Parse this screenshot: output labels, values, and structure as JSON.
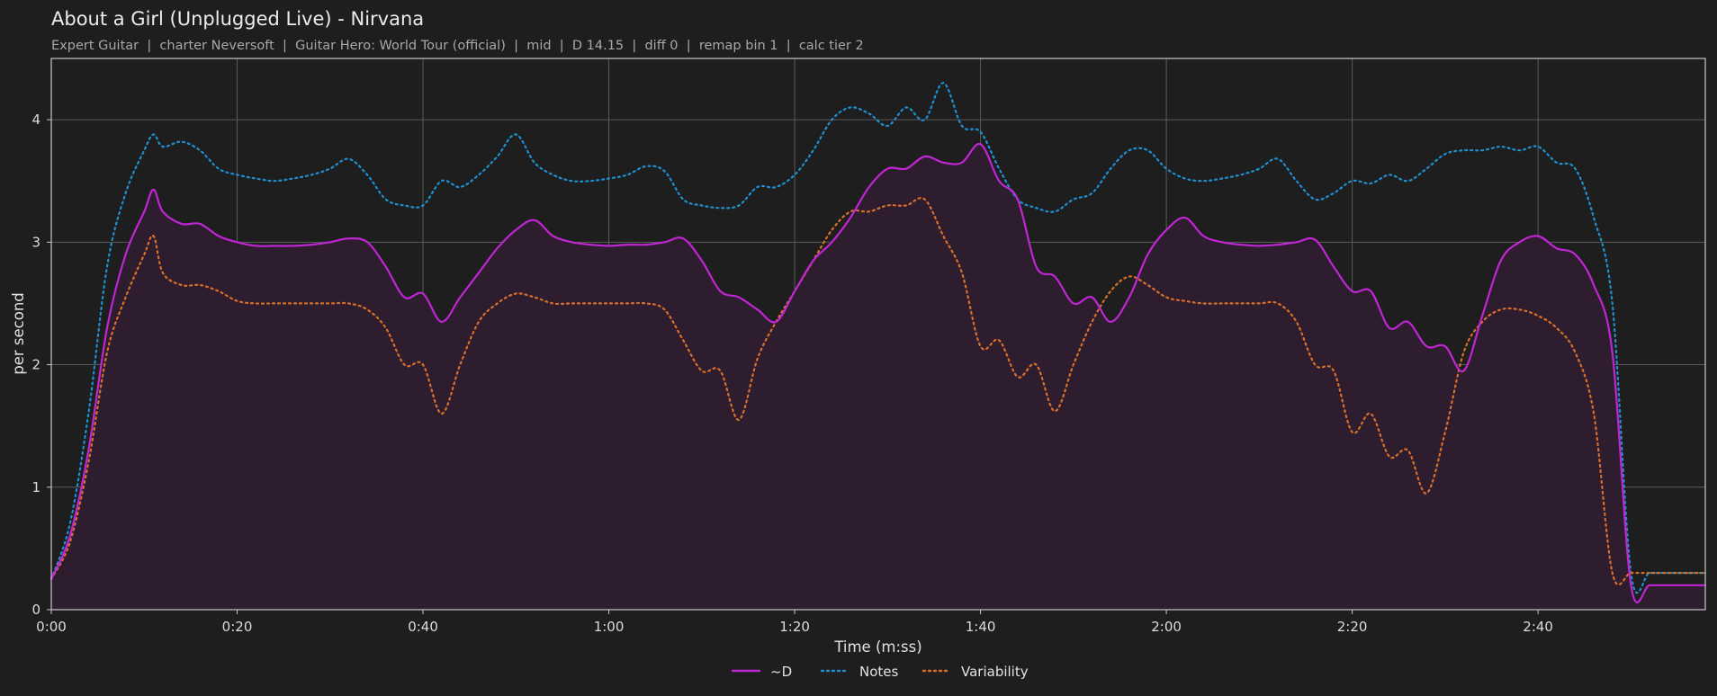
{
  "colors": {
    "background": "#1e1e1e",
    "plot_border": "#c8c8c8",
    "grid": "#5a5a5a",
    "d_line": "#c026d3",
    "d_fill": "#2e1c2f",
    "notes_line": "#1f8fd0",
    "variability_line": "#d9702a"
  },
  "chart_data": {
    "type": "line",
    "title": "About a Girl (Unplugged Live) - Nirvana",
    "subtitle": "Expert Guitar  |  charter Neversoft  |  Guitar Hero: World Tour (official)  |  mid  |  D 14.15  |  diff 0  |  remap bin 1  |  calc tier 2",
    "xlabel": "Time (m:ss)",
    "ylabel": "per second",
    "xlim": [
      0,
      178
    ],
    "ylim": [
      0,
      4.5
    ],
    "xticks": [
      0,
      20,
      40,
      60,
      80,
      100,
      120,
      140,
      160
    ],
    "xtick_labels": [
      "0:00",
      "0:20",
      "0:40",
      "1:00",
      "1:20",
      "1:40",
      "2:00",
      "2:20",
      "2:40"
    ],
    "yticks": [
      0,
      1,
      2,
      3,
      4
    ],
    "ytick_labels": [
      "0",
      "1",
      "2",
      "3",
      "4"
    ],
    "grid": true,
    "legend_position": "bottom-center",
    "x": [
      0,
      2,
      4,
      6,
      8,
      10,
      11,
      12,
      14,
      16,
      18,
      20,
      22,
      24,
      26,
      28,
      30,
      32,
      34,
      36,
      38,
      40,
      42,
      44,
      46,
      48,
      50,
      52,
      54,
      56,
      58,
      60,
      62,
      64,
      66,
      68,
      70,
      72,
      74,
      76,
      78,
      80,
      82,
      84,
      86,
      88,
      90,
      92,
      94,
      96,
      98,
      100,
      102,
      104,
      106,
      108,
      110,
      112,
      114,
      116,
      118,
      120,
      122,
      124,
      126,
      128,
      130,
      132,
      134,
      136,
      138,
      140,
      142,
      144,
      146,
      148,
      150,
      152,
      154,
      156,
      158,
      160,
      162,
      164,
      166,
      168,
      170,
      172,
      174,
      176,
      178
    ],
    "series": [
      {
        "name": "~D",
        "style": "solid",
        "values": [
          0.25,
          0.6,
          1.3,
          2.3,
          2.9,
          3.25,
          3.43,
          3.25,
          3.15,
          3.15,
          3.05,
          3.0,
          2.97,
          2.97,
          2.97,
          2.98,
          3.0,
          3.03,
          3.0,
          2.8,
          2.55,
          2.58,
          2.35,
          2.55,
          2.75,
          2.95,
          3.1,
          3.18,
          3.05,
          3.0,
          2.98,
          2.97,
          2.98,
          2.98,
          3.0,
          3.03,
          2.85,
          2.6,
          2.55,
          2.45,
          2.35,
          2.6,
          2.85,
          3.0,
          3.2,
          3.45,
          3.6,
          3.6,
          3.7,
          3.65,
          3.65,
          3.8,
          3.5,
          3.35,
          2.8,
          2.72,
          2.5,
          2.55,
          2.35,
          2.55,
          2.9,
          3.1,
          3.2,
          3.05,
          3.0,
          2.98,
          2.97,
          2.98,
          3.0,
          3.02,
          2.8,
          2.6,
          2.6,
          2.3,
          2.35,
          2.15,
          2.15,
          1.95,
          2.4,
          2.85,
          3.0,
          3.05,
          2.95,
          2.9,
          2.65,
          2.1,
          0.2,
          0.2,
          0.2,
          0.2,
          0.2
        ]
      },
      {
        "name": "Notes",
        "style": "dotted",
        "values": [
          0.25,
          0.7,
          1.6,
          2.8,
          3.4,
          3.75,
          3.88,
          3.78,
          3.82,
          3.75,
          3.6,
          3.55,
          3.52,
          3.5,
          3.52,
          3.55,
          3.6,
          3.68,
          3.55,
          3.35,
          3.3,
          3.3,
          3.5,
          3.45,
          3.55,
          3.7,
          3.88,
          3.65,
          3.55,
          3.5,
          3.5,
          3.52,
          3.55,
          3.62,
          3.58,
          3.35,
          3.3,
          3.28,
          3.3,
          3.45,
          3.45,
          3.55,
          3.75,
          4.0,
          4.1,
          4.05,
          3.95,
          4.1,
          4.0,
          4.3,
          3.95,
          3.9,
          3.6,
          3.35,
          3.28,
          3.25,
          3.35,
          3.4,
          3.6,
          3.75,
          3.75,
          3.6,
          3.52,
          3.5,
          3.52,
          3.55,
          3.6,
          3.68,
          3.5,
          3.35,
          3.4,
          3.5,
          3.48,
          3.55,
          3.5,
          3.6,
          3.72,
          3.75,
          3.75,
          3.78,
          3.75,
          3.78,
          3.65,
          3.6,
          3.2,
          2.5,
          0.3,
          0.3,
          0.3,
          0.3,
          0.3
        ]
      },
      {
        "name": "Variability",
        "style": "dotted",
        "values": [
          0.25,
          0.55,
          1.2,
          2.1,
          2.55,
          2.9,
          3.05,
          2.75,
          2.65,
          2.65,
          2.6,
          2.52,
          2.5,
          2.5,
          2.5,
          2.5,
          2.5,
          2.5,
          2.45,
          2.3,
          2.0,
          2.0,
          1.6,
          2.0,
          2.35,
          2.5,
          2.58,
          2.55,
          2.5,
          2.5,
          2.5,
          2.5,
          2.5,
          2.5,
          2.45,
          2.2,
          1.95,
          1.95,
          1.55,
          2.05,
          2.35,
          2.6,
          2.85,
          3.1,
          3.25,
          3.25,
          3.3,
          3.3,
          3.35,
          3.05,
          2.75,
          2.15,
          2.2,
          1.9,
          2.0,
          1.62,
          2.0,
          2.35,
          2.6,
          2.72,
          2.65,
          2.55,
          2.52,
          2.5,
          2.5,
          2.5,
          2.5,
          2.5,
          2.35,
          2.0,
          1.95,
          1.45,
          1.6,
          1.25,
          1.3,
          0.95,
          1.45,
          2.1,
          2.35,
          2.45,
          2.45,
          2.4,
          2.3,
          2.1,
          1.6,
          0.3,
          0.3,
          0.3,
          0.3,
          0.3,
          0.3
        ]
      }
    ]
  }
}
